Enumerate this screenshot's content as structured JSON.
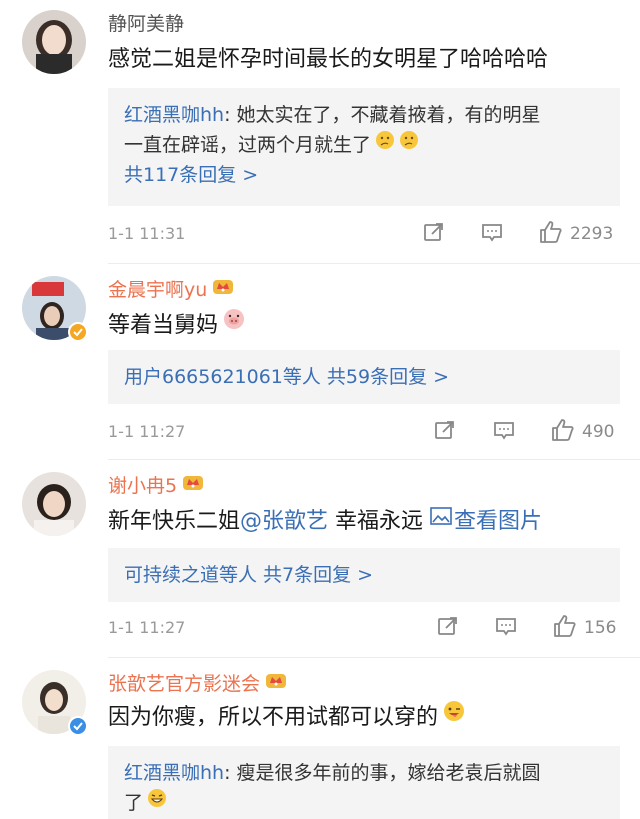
{
  "comments": [
    {
      "username": "静阿美静",
      "text": "感觉二姐是怀孕时间最长的女明星了哈哈哈哈",
      "reply": {
        "user": "红酒黑咖hh",
        "line1": ": 她太实在了，不藏着掖着，有的明星",
        "line2": "一直在辟谣，过两个月就生了",
        "more": "共117条回复 >"
      },
      "time": "1-1 11:31",
      "likes": "2293"
    },
    {
      "username": "金晨宇啊yu",
      "text": "等着当舅妈",
      "reply_summary": "用户6665621061等人  共59条回复 >",
      "time": "1-1 11:27",
      "likes": "490"
    },
    {
      "username": "谢小冉5",
      "text_prefix": "新年快乐二姐",
      "mention": "@张歆艺",
      "text_suffix": " 幸福永远 ",
      "picture_link": "查看图片",
      "reply_summary": "可持续之道等人  共7条回复 >",
      "time": "1-1 11:27",
      "likes": "156"
    },
    {
      "username": "张歆艺官方影迷会",
      "text": "因为你瘦，所以不用试都可以穿的",
      "reply": {
        "user": "红酒黑咖hh",
        "line1": ": 瘦是很多年前的事，嫁给老袁后就圆",
        "line2": "了"
      }
    }
  ],
  "colors": {
    "link": "#3a6fb5",
    "vip_name": "#eb7350",
    "reply_bg": "#f4f4f4",
    "muted": "#9a9a9a"
  },
  "icons": [
    "share-icon",
    "comment-icon",
    "like-icon",
    "crown-icon",
    "verified-icon",
    "thinking-emoji",
    "pig-emoji",
    "wink-emoji",
    "grin-emoji",
    "picture-icon"
  ]
}
